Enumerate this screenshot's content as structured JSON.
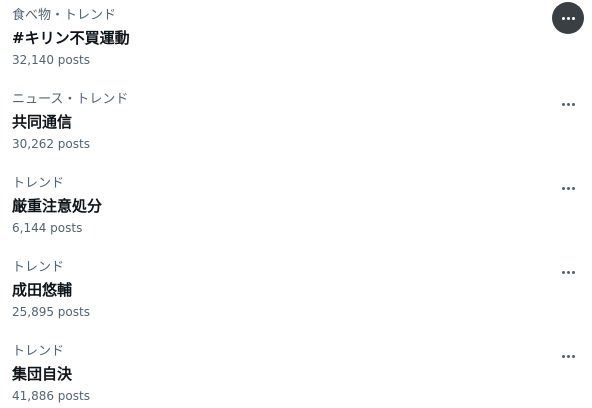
{
  "trends": [
    {
      "category": "食べ物・トレンド",
      "name": "#キリン不買運動",
      "count": "32,140 posts",
      "menu_icon": "more-horizontal-icon",
      "menu_active": true
    },
    {
      "category": "ニュース・トレンド",
      "name": "共同通信",
      "count": "30,262 posts",
      "menu_icon": "more-horizontal-icon",
      "menu_active": false
    },
    {
      "category": "トレンド",
      "name": "厳重注意処分",
      "count": "6,144 posts",
      "menu_icon": "more-horizontal-icon",
      "menu_active": false
    },
    {
      "category": "トレンド",
      "name": "成田悠輔",
      "count": "25,895 posts",
      "menu_icon": "more-horizontal-icon",
      "menu_active": false
    },
    {
      "category": "トレンド",
      "name": "集団自決",
      "count": "41,886 posts",
      "menu_icon": "more-horizontal-icon",
      "menu_active": false
    }
  ],
  "colors": {
    "primary_text": "#0f1419",
    "secondary_text": "#536471",
    "active_menu_bg": "#3a3f44"
  }
}
